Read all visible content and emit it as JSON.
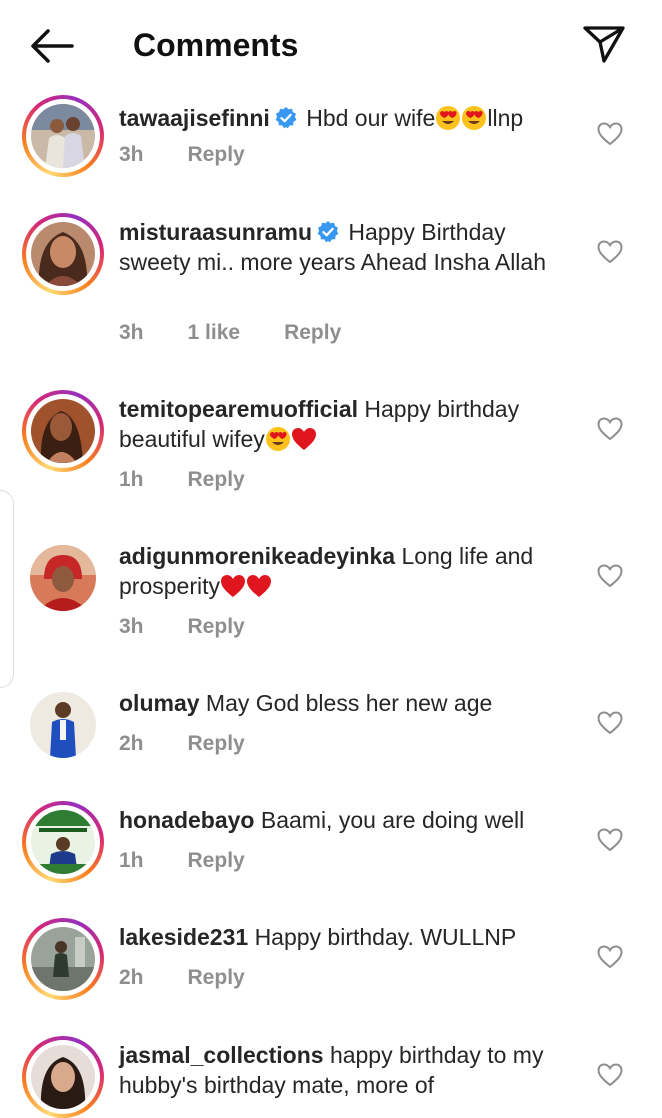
{
  "header": {
    "title": "Comments"
  },
  "comments": [
    {
      "username": "tawaajisefinni",
      "verified": true,
      "text": "Hbd our wife",
      "text_after": "llnp",
      "time": "3h",
      "likes": "",
      "reply": "Reply"
    },
    {
      "username": "misturaasunramu",
      "verified": true,
      "text": "Happy Birthday sweety mi.. more years Ahead Insha Allah",
      "time": "3h",
      "likes": "1 like",
      "reply": "Reply"
    },
    {
      "username": "temitopearemuofficial",
      "verified": false,
      "text": "Happy birthday beautiful wifey",
      "time": "1h",
      "likes": "",
      "reply": "Reply"
    },
    {
      "username": "adigunmorenikeadeyinka",
      "verified": false,
      "text": "Long life and prosperity",
      "time": "3h",
      "likes": "",
      "reply": "Reply"
    },
    {
      "username": "olumay",
      "verified": false,
      "text": "May God bless her new age",
      "time": "2h",
      "likes": "",
      "reply": "Reply"
    },
    {
      "username": "honadebayo",
      "verified": false,
      "text": "Baami, you are doing well",
      "time": "1h",
      "likes": "",
      "reply": "Reply"
    },
    {
      "username": "lakeside231",
      "verified": false,
      "text": "Happy birthday. WULLNP",
      "time": "2h",
      "likes": "",
      "reply": "Reply"
    },
    {
      "username": "jasmal_collections",
      "verified": false,
      "text": "happy birthday to my hubby's birthday mate, more of",
      "time": "",
      "likes": "",
      "reply": ""
    }
  ],
  "colors": {
    "verified": "#3897f0",
    "heart_emoji": "#e0161e",
    "meta": "#8e8e8e"
  }
}
